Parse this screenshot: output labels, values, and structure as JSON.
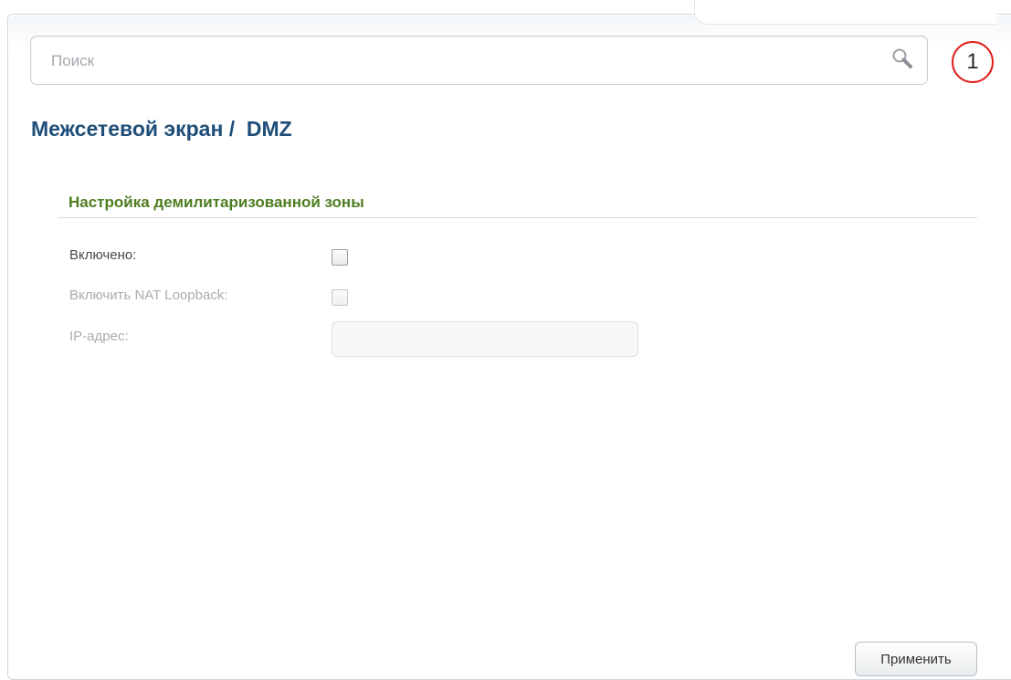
{
  "search": {
    "placeholder": "Поиск",
    "value": ""
  },
  "notifications": {
    "count": "1",
    "badge_color": "#e0201a"
  },
  "page": {
    "title": "Межсетевой экран /  DMZ"
  },
  "section": {
    "title": "Настройка демилитаризованной зоны"
  },
  "form": {
    "enabled": {
      "label": "Включено:",
      "checked": false
    },
    "nat_loopback": {
      "label": "Включить NAT Loopback:",
      "checked": false,
      "disabled": true
    },
    "ip_address": {
      "label": "IP-адрес:",
      "value": "",
      "disabled": true
    }
  },
  "actions": {
    "apply_label": "Применить"
  },
  "colors": {
    "title": "#1f4e79",
    "section_title": "#4e7d20",
    "disabled_text": "#a9adb1"
  }
}
